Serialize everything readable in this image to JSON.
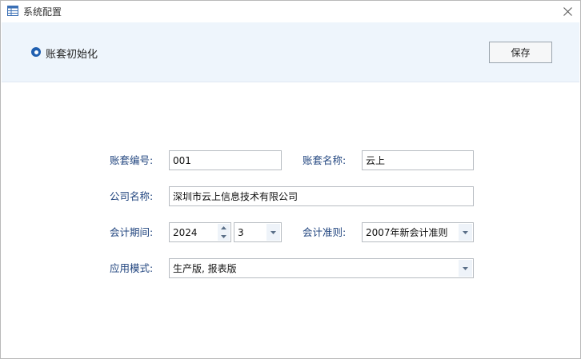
{
  "window": {
    "title": "系统配置"
  },
  "header": {
    "radio_label": "账套初始化",
    "save_label": "保存"
  },
  "form": {
    "account_code_label": "账套编号:",
    "account_code_value": "001",
    "account_name_label": "账套名称:",
    "account_name_value": "云上",
    "company_name_label": "公司名称:",
    "company_name_value": "深圳市云上信息技术有限公司",
    "period_label": "会计期间:",
    "period_year": "2024",
    "period_month": "3",
    "standard_label": "会计准则:",
    "standard_value": "2007年新会计准则",
    "mode_label": "应用模式:",
    "mode_value": "生产版, 报表版"
  },
  "colors": {
    "accent": "#1f5fb0",
    "header_band": "#eef5fc",
    "label": "#21457f"
  }
}
